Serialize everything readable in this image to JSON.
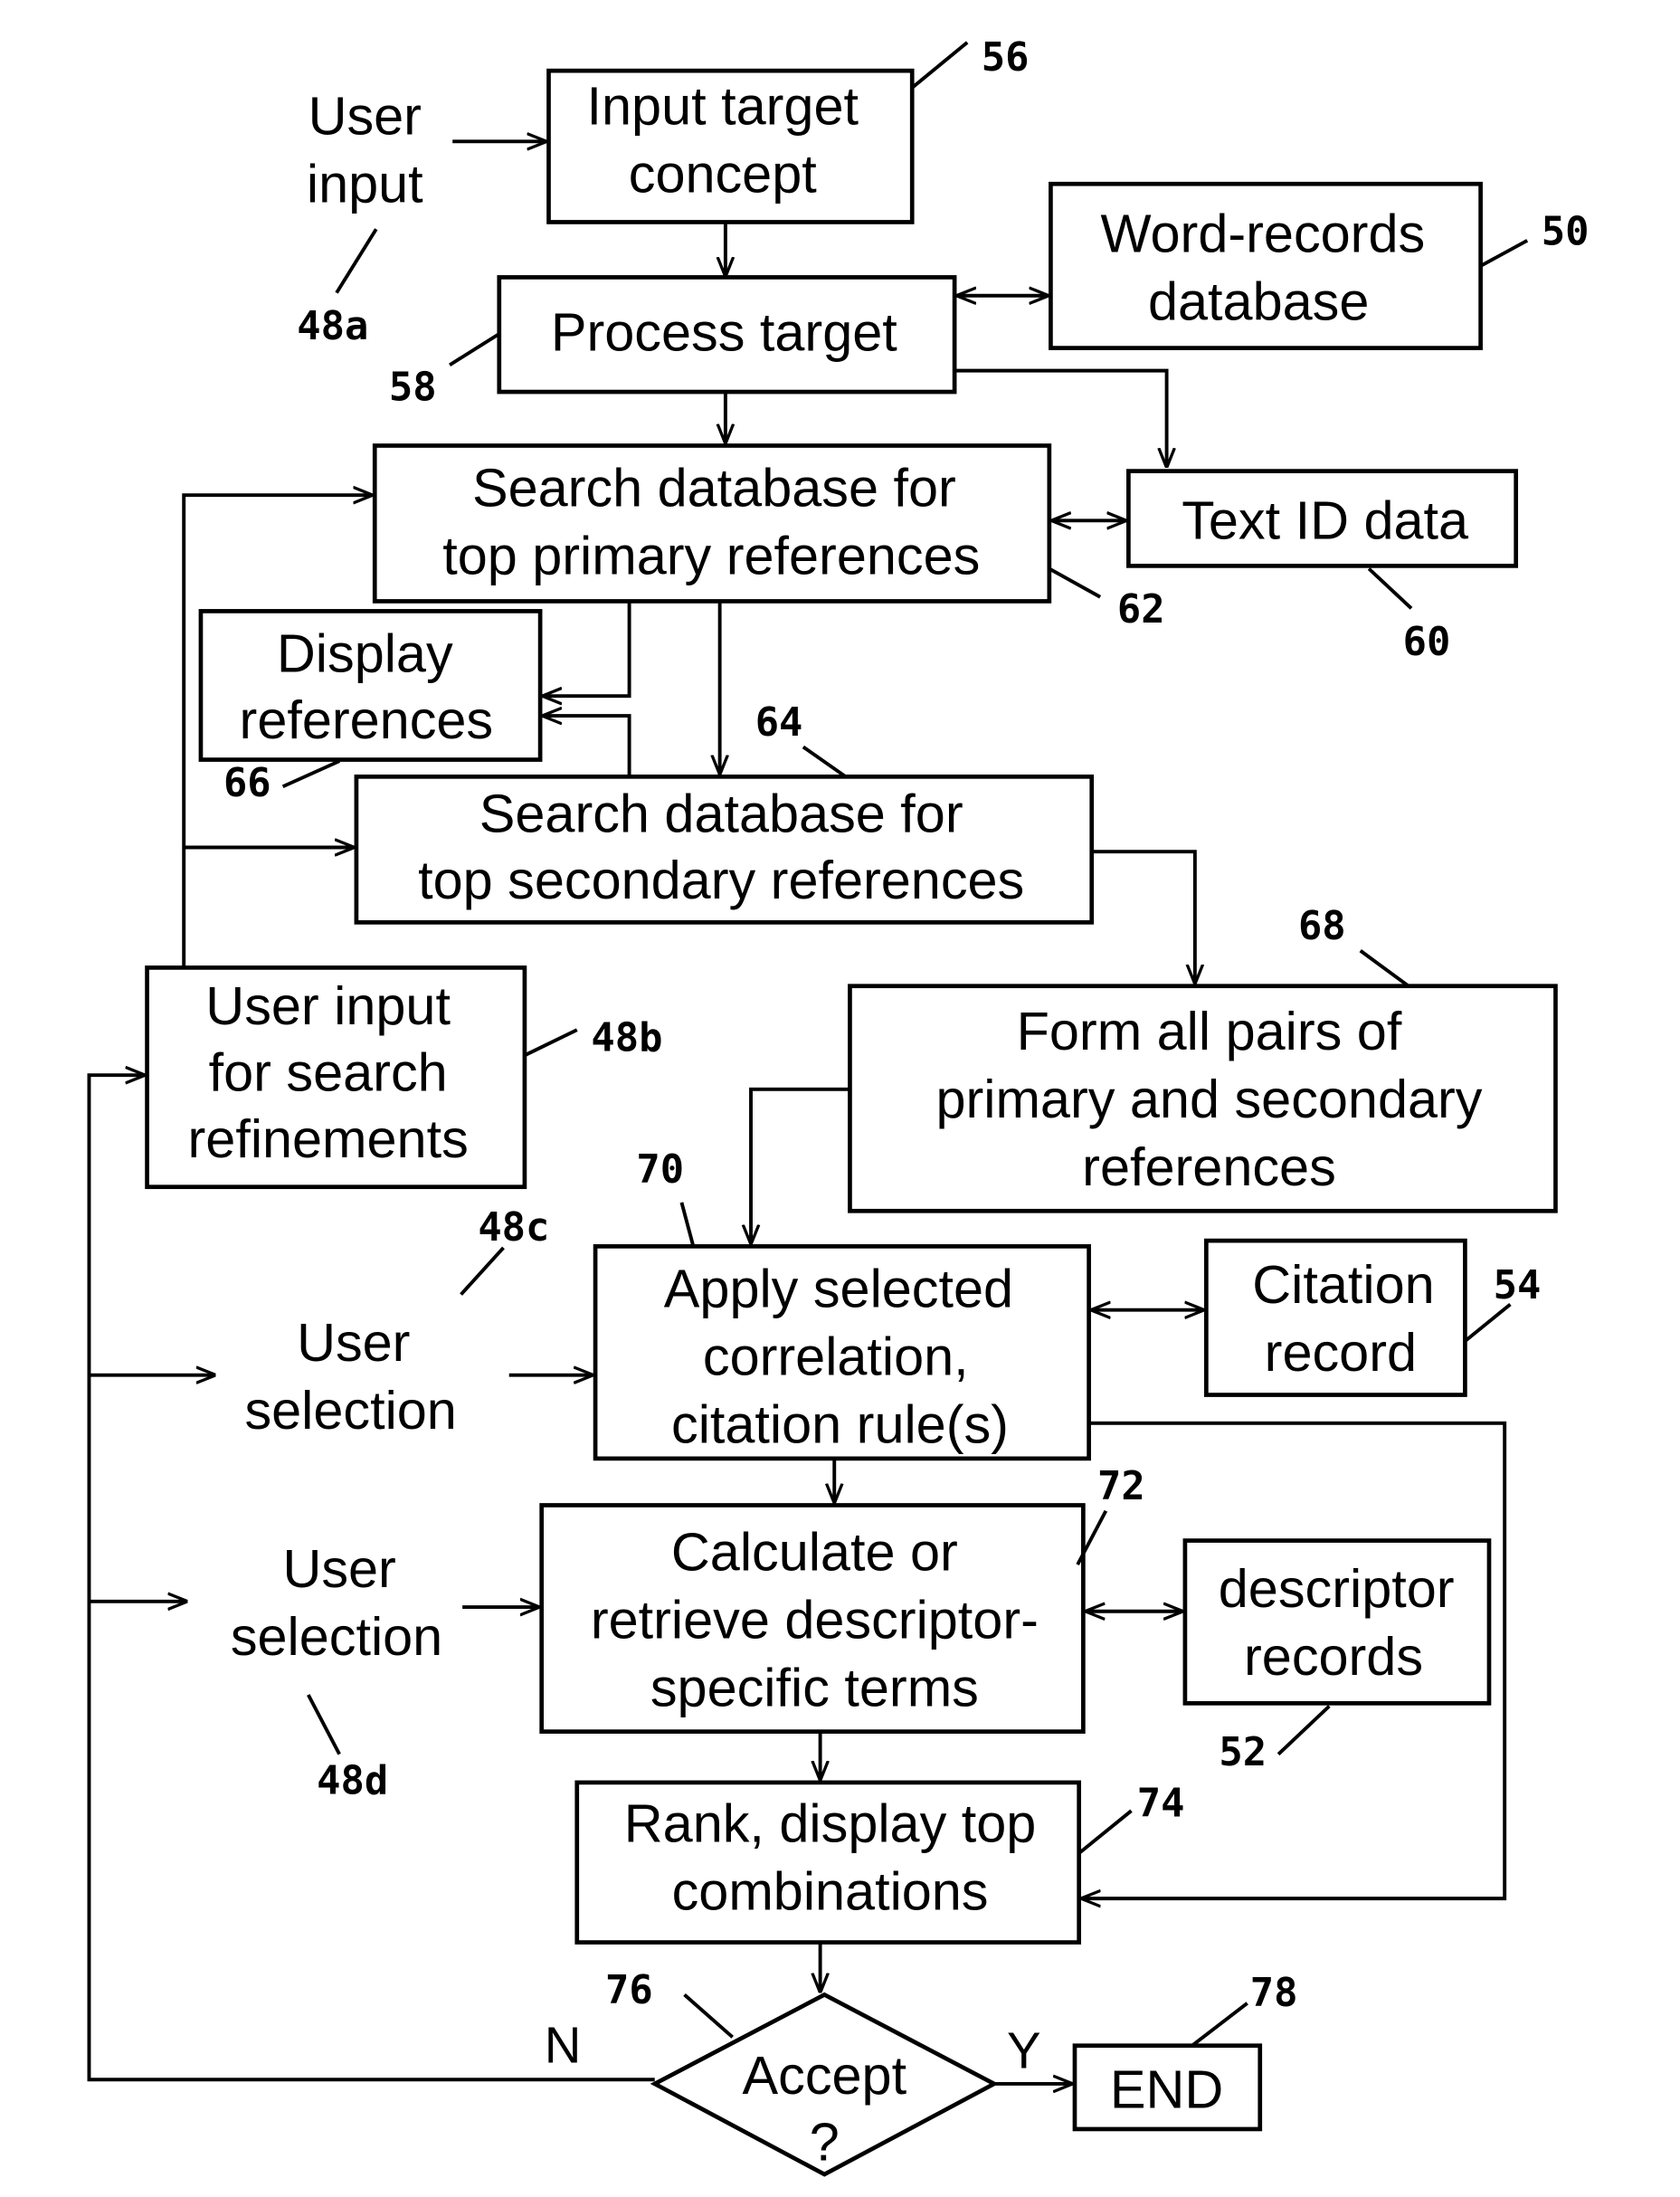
{
  "diagram": {
    "type": "flowchart",
    "nodes": {
      "user_input_a": {
        "lines": [
          "User",
          "input"
        ],
        "ref": "48a"
      },
      "input_target": {
        "lines": [
          "Input target",
          "concept"
        ],
        "ref": "56"
      },
      "word_records": {
        "lines": [
          "Word-records",
          "database"
        ],
        "ref": "50"
      },
      "process_target": {
        "lines": [
          "Process target"
        ],
        "ref": "58"
      },
      "search_primary": {
        "lines": [
          "Search database for",
          "top primary references"
        ],
        "ref": "62"
      },
      "text_id": {
        "lines": [
          "Text ID data"
        ],
        "ref": "60"
      },
      "display_refs": {
        "lines": [
          "Display",
          "references"
        ],
        "ref": "66"
      },
      "search_secondary": {
        "lines": [
          "Search database for",
          "top secondary references"
        ],
        "ref": "64"
      },
      "user_refine": {
        "lines": [
          "User input",
          "for search",
          "refinements"
        ],
        "ref": "48b"
      },
      "form_pairs": {
        "lines": [
          "Form all pairs of",
          "primary and secondary",
          "references"
        ],
        "ref": "68"
      },
      "user_selection_c": {
        "lines": [
          "User",
          "selection"
        ],
        "ref": "48c"
      },
      "apply_rules": {
        "lines": [
          "Apply selected",
          "correlation,",
          "citation rule(s)"
        ],
        "ref": "70"
      },
      "citation_record": {
        "lines": [
          "Citation",
          "record"
        ],
        "ref": "54"
      },
      "user_selection_d": {
        "lines": [
          "User",
          "selection"
        ],
        "ref": "48d"
      },
      "calculate": {
        "lines": [
          "Calculate or",
          "retrieve descriptor-",
          "specific terms"
        ],
        "ref": "72"
      },
      "descriptor_records": {
        "lines": [
          "descriptor",
          "records"
        ],
        "ref": "52"
      },
      "rank": {
        "lines": [
          "Rank, display top",
          "combinations"
        ],
        "ref": "74"
      },
      "accept": {
        "lines": [
          "Accept",
          "?"
        ],
        "ref": "76"
      },
      "end": {
        "lines": [
          "END"
        ],
        "ref": "78"
      }
    },
    "branch_labels": {
      "no": "N",
      "yes": "Y"
    }
  }
}
